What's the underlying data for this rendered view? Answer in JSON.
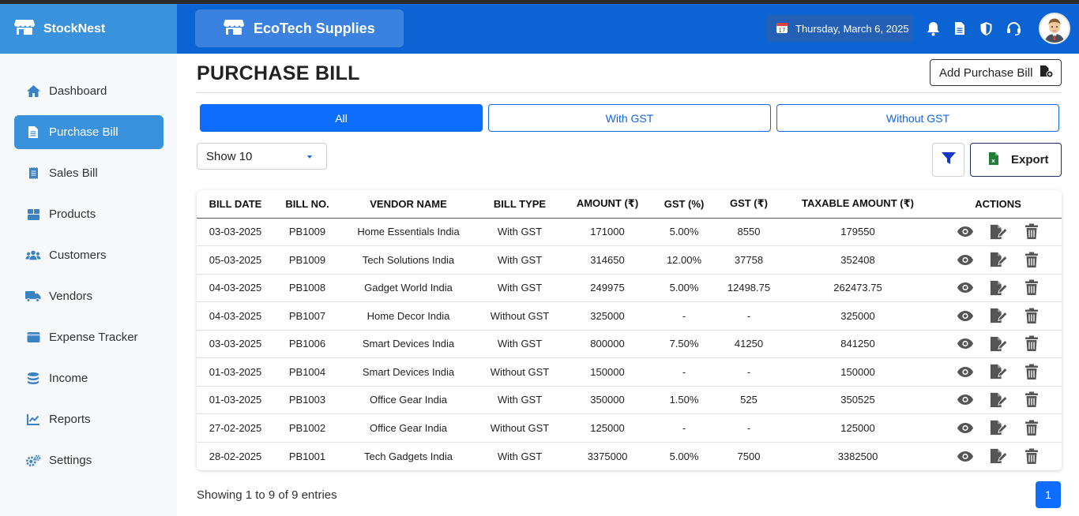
{
  "app": {
    "name": "StockNest",
    "shop_name": "EcoTech Supplies"
  },
  "header": {
    "date": "Thursday, March 6, 2025"
  },
  "sidebar": {
    "items": [
      {
        "label": "Dashboard",
        "icon": "home-icon"
      },
      {
        "label": "Purchase Bill",
        "icon": "file-icon",
        "active": true
      },
      {
        "label": "Sales Bill",
        "icon": "receipt-icon"
      },
      {
        "label": "Products",
        "icon": "boxes-icon"
      },
      {
        "label": "Customers",
        "icon": "users-icon"
      },
      {
        "label": "Vendors",
        "icon": "truck-icon"
      },
      {
        "label": "Expense Tracker",
        "icon": "wallet-icon"
      },
      {
        "label": "Income",
        "icon": "coins-icon"
      },
      {
        "label": "Reports",
        "icon": "chart-line-icon"
      },
      {
        "label": "Settings",
        "icon": "cogs-icon"
      }
    ]
  },
  "page": {
    "title": "PURCHASE BILL",
    "add_button": "Add Purchase Bill",
    "tabs": [
      {
        "label": "All",
        "active": true
      },
      {
        "label": "With GST",
        "active": false
      },
      {
        "label": "Without GST",
        "active": false
      }
    ],
    "show_select": "Show 10",
    "export_label": "Export",
    "entries_text": "Showing 1 to 9 of 9 entries",
    "current_page": "1"
  },
  "table": {
    "columns": [
      "BILL DATE",
      "BILL NO.",
      "VENDOR NAME",
      "BILL TYPE",
      "AMOUNT (₹)",
      "GST (%)",
      "GST (₹)",
      "TAXABLE AMOUNT (₹)",
      "ACTIONS"
    ],
    "rows": [
      [
        "03-03-2025",
        "PB1009",
        "Home Essentials India",
        "With GST",
        "171000",
        "5.00%",
        "8550",
        "179550"
      ],
      [
        "05-03-2025",
        "PB1009",
        "Tech Solutions India",
        "With GST",
        "314650",
        "12.00%",
        "37758",
        "352408"
      ],
      [
        "04-03-2025",
        "PB1008",
        "Gadget World India",
        "With GST",
        "249975",
        "5.00%",
        "12498.75",
        "262473.75"
      ],
      [
        "04-03-2025",
        "PB1007",
        "Home Decor India",
        "Without GST",
        "325000",
        "-",
        "-",
        "325000"
      ],
      [
        "03-03-2025",
        "PB1006",
        "Smart Devices India",
        "With GST",
        "800000",
        "7.50%",
        "41250",
        "841250"
      ],
      [
        "01-03-2025",
        "PB1004",
        "Smart Devices India",
        "Without GST",
        "150000",
        "-",
        "-",
        "150000"
      ],
      [
        "01-03-2025",
        "PB1003",
        "Office Gear India",
        "With GST",
        "350000",
        "1.50%",
        "525",
        "350525"
      ],
      [
        "27-02-2025",
        "PB1002",
        "Office Gear India",
        "Without GST",
        "125000",
        "-",
        "-",
        "125000"
      ],
      [
        "28-02-2025",
        "PB1001",
        "Tech Gadgets India",
        "With GST",
        "3375000",
        "5.00%",
        "7500",
        "3382500"
      ]
    ]
  },
  "colors": {
    "header_bg": "#0c63d4",
    "brand_bg": "#3b92dc",
    "primary": "#0d6efd",
    "sidebar_bg": "#f7f8fa"
  }
}
